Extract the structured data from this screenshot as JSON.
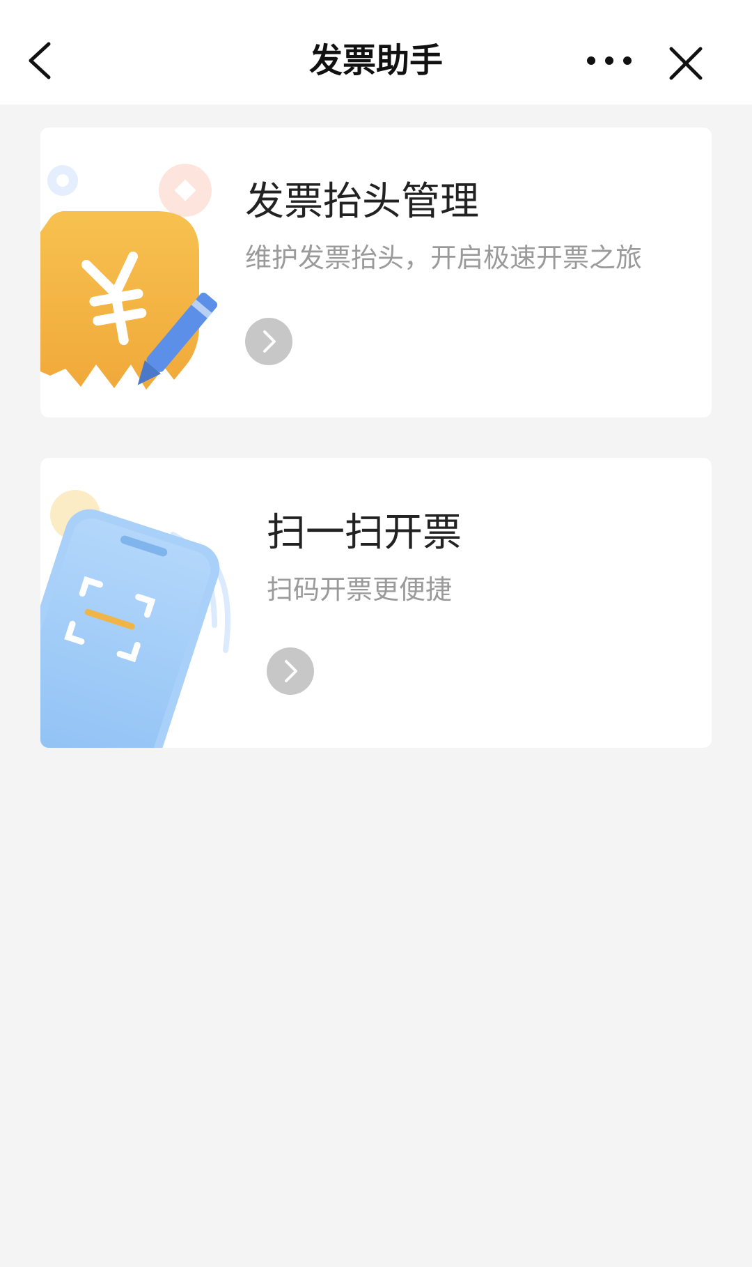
{
  "navbar": {
    "title": "发票助手",
    "back_icon": "chevron-left-icon",
    "more_icon": "more-dots-icon",
    "close_icon": "close-icon"
  },
  "cards": [
    {
      "title": "发票抬头管理",
      "subtitle": "维护发票抬头，开启极速开票之旅",
      "illustration": "invoice-yuan-pencil-icon",
      "arrow_icon": "chevron-right-icon"
    },
    {
      "title": "扫一扫开票",
      "subtitle": "扫码开票更便捷",
      "illustration": "phone-scan-icon",
      "arrow_icon": "chevron-right-icon"
    }
  ],
  "colors": {
    "background": "#f4f4f4",
    "card": "#ffffff",
    "invoice_orange": "#f2b13f",
    "pencil_blue": "#5b8fe8",
    "phone_blue": "#9cc8f7",
    "arrow_gray": "#c7c7c7"
  }
}
